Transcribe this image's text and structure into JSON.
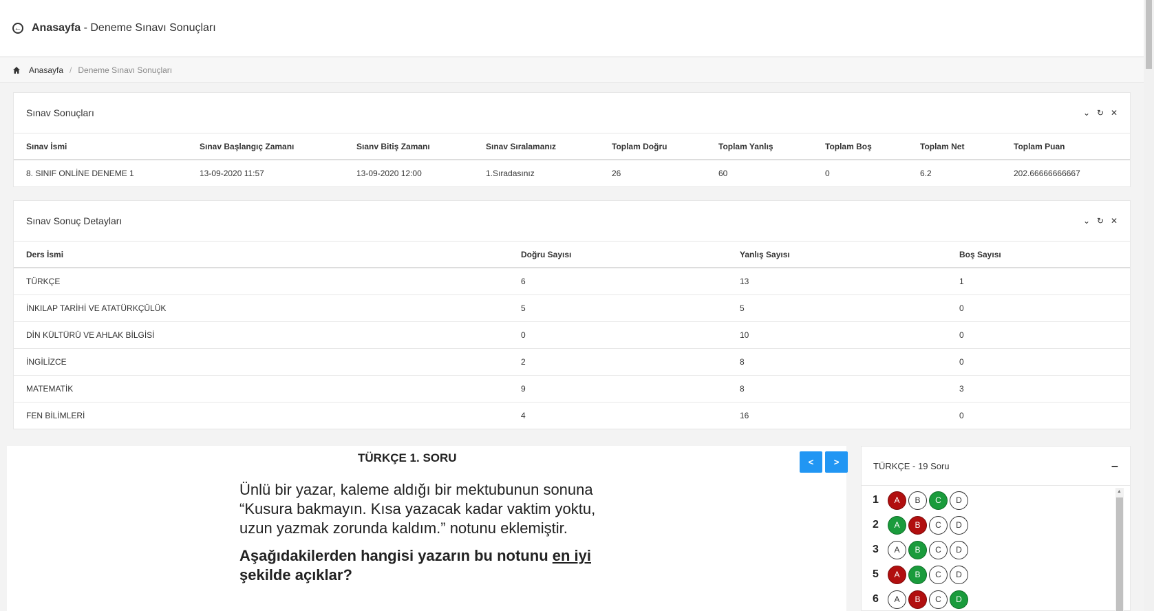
{
  "header": {
    "title_main": "Anasayfa",
    "title_rest": " - Deneme Sınavı Sonuçları"
  },
  "breadcrumb": {
    "home": "Anasayfa",
    "separator": "/",
    "current": "Deneme Sınavı Sonuçları"
  },
  "results_panel": {
    "title": "Sınav Sonuçları",
    "columns": [
      "Sınav İsmi",
      "Sınav Başlangıç Zamanı",
      "Sıanv Bitiş Zamanı",
      "Sınav Sıralamanız",
      "Toplam Doğru",
      "Toplam Yanlış",
      "Toplam Boş",
      "Toplam Net",
      "Toplam Puan"
    ],
    "row": [
      "8. SINIF ONLİNE DENEME 1",
      "13-09-2020 11:57",
      "13-09-2020 12:00",
      "1.Sıradasınız",
      "26",
      "60",
      "0",
      "6.2",
      "202.66666666667"
    ]
  },
  "details_panel": {
    "title": "Sınav Sonuç Detayları",
    "columns": [
      "Ders İsmi",
      "Doğru Sayısı",
      "Yanlış Sayısı",
      "Boş Sayısı"
    ],
    "rows": [
      [
        "TÜRKÇE",
        "6",
        "13",
        "1"
      ],
      [
        "İNKILAP TARİHİ VE ATATÜRKÇÜLÜK",
        "5",
        "5",
        "0"
      ],
      [
        "DİN KÜLTÜRÜ VE AHLAK BİLGİSİ",
        "0",
        "10",
        "0"
      ],
      [
        "İNGİLİZCE",
        "2",
        "8",
        "0"
      ],
      [
        "MATEMATİK",
        "9",
        "8",
        "3"
      ],
      [
        "FEN BİLİMLERİ",
        "4",
        "16",
        "0"
      ]
    ]
  },
  "question": {
    "title": "TÜRKÇE 1. SORU",
    "prev_label": "<",
    "next_label": ">",
    "paragraph": "Ünlü bir yazar, kaleme aldığı bir mektubunun sonuna “Kusura bakmayın. Kısa yazacak kadar vaktim yoktu, uzun yazmak zorunda kaldım.” notunu eklemiştir.",
    "ask_before": "Aşağıdakilerden hangisi yazarın bu notunu ",
    "ask_underlined": "en iyi",
    "ask_after": " şekilde açıklar?"
  },
  "answer_panel": {
    "title": "TÜRKÇE - 19 Soru",
    "minimize_label": "–",
    "items": [
      {
        "num": "1",
        "options": [
          {
            "label": "A",
            "state": "wrong"
          },
          {
            "label": "B",
            "state": "none"
          },
          {
            "label": "C",
            "state": "correct"
          },
          {
            "label": "D",
            "state": "none"
          }
        ]
      },
      {
        "num": "2",
        "options": [
          {
            "label": "A",
            "state": "correct"
          },
          {
            "label": "B",
            "state": "wrong"
          },
          {
            "label": "C",
            "state": "none"
          },
          {
            "label": "D",
            "state": "none"
          }
        ]
      },
      {
        "num": "3",
        "options": [
          {
            "label": "A",
            "state": "none"
          },
          {
            "label": "B",
            "state": "correct"
          },
          {
            "label": "C",
            "state": "none"
          },
          {
            "label": "D",
            "state": "none"
          }
        ]
      },
      {
        "num": "5",
        "options": [
          {
            "label": "A",
            "state": "wrong"
          },
          {
            "label": "B",
            "state": "correct"
          },
          {
            "label": "C",
            "state": "none"
          },
          {
            "label": "D",
            "state": "none"
          }
        ]
      },
      {
        "num": "6",
        "options": [
          {
            "label": "A",
            "state": "none"
          },
          {
            "label": "B",
            "state": "wrong"
          },
          {
            "label": "C",
            "state": "none"
          },
          {
            "label": "D",
            "state": "correct"
          }
        ]
      }
    ]
  },
  "icons": {
    "back": "back-circle-arrow-icon",
    "home": "home-icon",
    "collapse": "chevron-down-icon",
    "refresh": "refresh-icon",
    "close": "close-icon"
  },
  "colors": {
    "accent": "#2196f3",
    "correct": "#1a9b3c",
    "wrong": "#b10f0f"
  }
}
